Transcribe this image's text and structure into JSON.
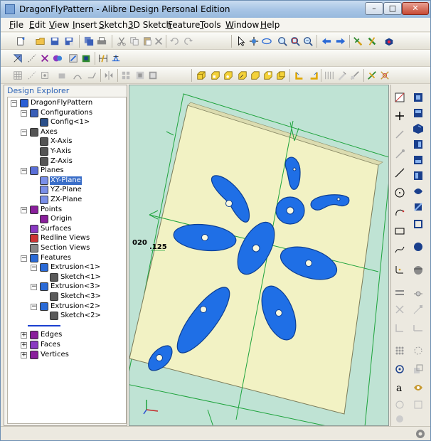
{
  "window": {
    "title": "DragonFlyPattern - Alibre Design Personal Edition",
    "minimize_glyph": "–",
    "maximize_glyph": "□",
    "close_glyph": "✕"
  },
  "menu": [
    {
      "label": "File",
      "key": "F",
      "rest": "ile"
    },
    {
      "label": "Edit",
      "key": "E",
      "rest": "dit"
    },
    {
      "label": "View",
      "key": "V",
      "rest": "iew"
    },
    {
      "label": "Insert",
      "key": "I",
      "rest": "nsert"
    },
    {
      "label": "Sketch",
      "key": "S",
      "rest": "ketch"
    },
    {
      "label": "3D Sketch",
      "key": "3",
      "rest": "D Sketch"
    },
    {
      "label": "Feature",
      "key": "F",
      "rest": "eature"
    },
    {
      "label": "Tools",
      "key": "T",
      "rest": "ools"
    },
    {
      "label": "Window",
      "key": "W",
      "rest": "indow"
    },
    {
      "label": "Help",
      "key": "H",
      "rest": "elp"
    }
  ],
  "explorer": {
    "header": "Design Explorer",
    "tree": [
      {
        "label": "DragonFlyPattern",
        "icon": "part-icon",
        "expander": "−",
        "level": 0
      },
      {
        "label": "Configurations",
        "icon": "configurations-icon",
        "expander": "−",
        "level": 1
      },
      {
        "label": "Config<1>",
        "icon": "config-icon",
        "expander": "",
        "level": 2
      },
      {
        "label": "Axes",
        "icon": "axes-icon",
        "expander": "−",
        "level": 1
      },
      {
        "label": "X-Axis",
        "icon": "axis-icon",
        "expander": "",
        "level": 2
      },
      {
        "label": "Y-Axis",
        "icon": "axis-icon",
        "expander": "",
        "level": 2
      },
      {
        "label": "Z-Axis",
        "icon": "axis-icon",
        "expander": "",
        "level": 2
      },
      {
        "label": "Planes",
        "icon": "planes-icon",
        "expander": "−",
        "level": 1
      },
      {
        "label": "XY-Plane",
        "icon": "plane-icon",
        "expander": "",
        "level": 2,
        "selected": true
      },
      {
        "label": "YZ-Plane",
        "icon": "plane-icon",
        "expander": "",
        "level": 2
      },
      {
        "label": "ZX-Plane",
        "icon": "plane-icon",
        "expander": "",
        "level": 2
      },
      {
        "label": "Points",
        "icon": "points-icon",
        "expander": "−",
        "level": 1
      },
      {
        "label": "Origin",
        "icon": "origin-icon",
        "expander": "",
        "level": 2
      },
      {
        "label": "Surfaces",
        "icon": "surfaces-icon",
        "expander": "",
        "level": 1
      },
      {
        "label": "Redline Views",
        "icon": "redline-icon",
        "expander": "",
        "level": 1
      },
      {
        "label": "Section Views",
        "icon": "section-icon",
        "expander": "",
        "level": 1
      },
      {
        "label": "Features",
        "icon": "features-icon",
        "expander": "−",
        "level": 1
      },
      {
        "label": "Extrusion<1>",
        "icon": "extrusion-icon",
        "expander": "−",
        "level": 2
      },
      {
        "label": "Sketch<1>",
        "icon": "sketch-icon",
        "expander": "",
        "level": 3
      },
      {
        "label": "Extrusion<3>",
        "icon": "extrusion-icon",
        "expander": "−",
        "level": 2
      },
      {
        "label": "Sketch<3>",
        "icon": "sketch-icon",
        "expander": "",
        "level": 3
      },
      {
        "label": "Extrusion<2>",
        "icon": "extrusion-icon",
        "expander": "−",
        "level": 2
      },
      {
        "label": "Sketch<2>",
        "icon": "sketch-icon",
        "expander": "",
        "level": 3
      },
      {
        "label": "",
        "icon": "rollback-marker-icon",
        "expander": "",
        "level": 1
      },
      {
        "label": "Edges",
        "icon": "edges-icon",
        "expander": "+",
        "level": 1
      },
      {
        "label": "Faces",
        "icon": "faces-icon",
        "expander": "+",
        "level": 1
      },
      {
        "label": "Vertices",
        "icon": "vertices-icon",
        "expander": "+",
        "level": 1
      }
    ]
  },
  "viewport": {
    "dimension_1": "020",
    "dimension_2": ".125"
  },
  "colors": {
    "viewport_bg": "#bfe3d4",
    "plate": "#f2f2c4",
    "part_blue": "#1f6fe6",
    "sketch_green": "#1ea33c",
    "selection_blue": "#3a6ec8"
  }
}
